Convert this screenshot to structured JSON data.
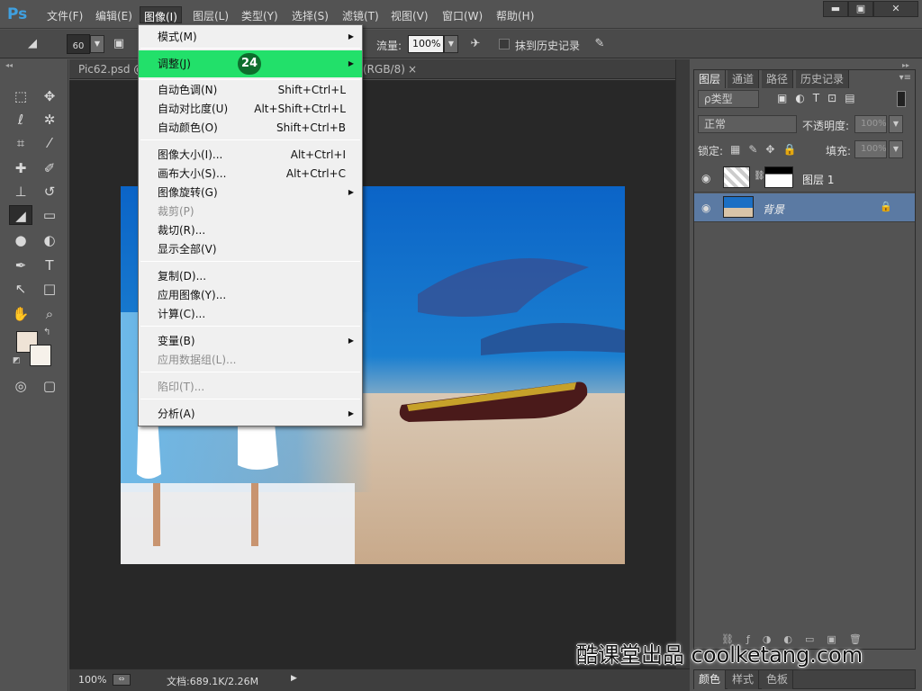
{
  "app": {
    "logo": "Ps"
  },
  "menubar": {
    "items": [
      "文件(F)",
      "编辑(E)",
      "图像(I)",
      "图层(L)",
      "类型(Y)",
      "选择(S)",
      "滤镜(T)",
      "视图(V)",
      "窗口(W)",
      "帮助(H)"
    ],
    "active": "图像(I)"
  },
  "window_controls": {
    "minimize": "▬",
    "maximize": "▣",
    "close": "✕"
  },
  "options": {
    "brush_size": "60",
    "flow_label": "流量:",
    "flow_value": "100%",
    "erase_history_label": "抹到历史记录"
  },
  "document": {
    "tab_name": "Pic62.psd @",
    "tab_mode": "(RGB/8)",
    "tab_close": "×",
    "zoom": "100%",
    "doc_info": "文档:689.1K/2.26M"
  },
  "image_menu": {
    "step_badge": "24",
    "items": [
      {
        "label": "模式(M)",
        "shortcut": "",
        "submenu": true,
        "disabled": false
      },
      {
        "label": "调整(J)",
        "shortcut": "",
        "submenu": true,
        "disabled": false,
        "highlighted": true
      },
      {
        "label": "自动色调(N)",
        "shortcut": "Shift+Ctrl+L"
      },
      {
        "label": "自动对比度(U)",
        "shortcut": "Alt+Shift+Ctrl+L"
      },
      {
        "label": "自动颜色(O)",
        "shortcut": "Shift+Ctrl+B"
      },
      {
        "label": "图像大小(I)...",
        "shortcut": "Alt+Ctrl+I"
      },
      {
        "label": "画布大小(S)...",
        "shortcut": "Alt+Ctrl+C"
      },
      {
        "label": "图像旋转(G)",
        "shortcut": "",
        "submenu": true
      },
      {
        "label": "裁剪(P)",
        "shortcut": "",
        "disabled": true
      },
      {
        "label": "裁切(R)...",
        "shortcut": ""
      },
      {
        "label": "显示全部(V)",
        "shortcut": ""
      },
      {
        "label": "复制(D)...",
        "shortcut": ""
      },
      {
        "label": "应用图像(Y)...",
        "shortcut": ""
      },
      {
        "label": "计算(C)...",
        "shortcut": ""
      },
      {
        "label": "变量(B)",
        "shortcut": "",
        "submenu": true
      },
      {
        "label": "应用数据组(L)...",
        "shortcut": "",
        "disabled": true
      },
      {
        "label": "陷印(T)...",
        "shortcut": "",
        "disabled": true
      },
      {
        "label": "分析(A)",
        "shortcut": "",
        "submenu": true
      }
    ]
  },
  "layers_panel": {
    "tabs": [
      "图层",
      "通道",
      "路径",
      "历史记录"
    ],
    "filter_label": "ρ类型",
    "blend_mode": "正常",
    "opacity_label": "不透明度:",
    "opacity_value": "100%",
    "lock_label": "锁定:",
    "fill_label": "填充:",
    "fill_value": "100%",
    "layers": [
      {
        "name": "图层 1",
        "selected": false
      },
      {
        "name": "背景",
        "selected": true,
        "locked": true
      }
    ]
  },
  "bottom_panel": {
    "tabs": [
      "颜色",
      "样式",
      "色板"
    ]
  },
  "watermark": "酷课堂出品 coolketang.com",
  "colors": {
    "highlight": "#22e06a",
    "badge": "#0d6e2d",
    "selected_layer": "#5b7aa3"
  }
}
